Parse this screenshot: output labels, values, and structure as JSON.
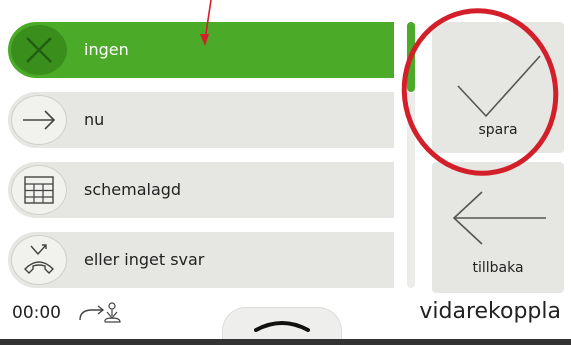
{
  "options": [
    {
      "label": "ingen",
      "icon": "x-icon",
      "selected": true
    },
    {
      "label": "nu",
      "icon": "arrow-right-icon",
      "selected": false
    },
    {
      "label": "schemalagd",
      "icon": "calendar-icon",
      "selected": false
    },
    {
      "label": "eller inget svar",
      "icon": "missed-call-icon",
      "selected": false
    }
  ],
  "actions": {
    "save_label": "spara",
    "back_label": "tillbaka"
  },
  "status": {
    "time": "00:00",
    "forward_icon": "call-forward-icon"
  },
  "footer": {
    "title": "vidarekoppla",
    "tab_icon": "chevron-up-icon"
  },
  "colors": {
    "selected": "#4caa29",
    "annotation": "#d21f2a"
  }
}
